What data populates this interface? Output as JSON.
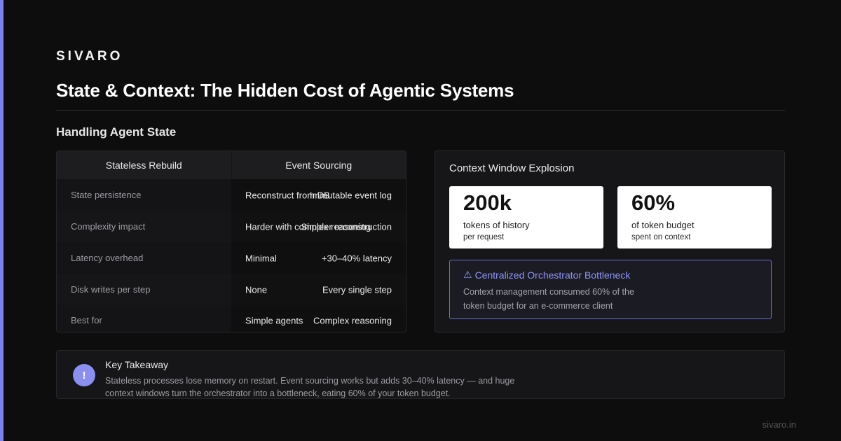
{
  "brand": "SIVARO",
  "title": "State & Context: The Hidden Cost of Agentic Systems",
  "section_title": "Handling Agent State",
  "table": {
    "headers": [
      "Stateless Rebuild",
      "Event Sourcing"
    ],
    "rows": [
      {
        "label": "State persistence",
        "stateless": "Reconstruct from DB",
        "event": "Immutable event log"
      },
      {
        "label": "Complexity impact",
        "stateless": "Harder with complex reasoning",
        "event": "Simpler reconstruction"
      },
      {
        "label": "Latency overhead",
        "stateless": "Minimal",
        "event": "+30–40% latency"
      },
      {
        "label": "Disk writes per step",
        "stateless": "None",
        "event": "Every single step"
      },
      {
        "label": "Best for",
        "stateless": "Simple agents",
        "event": "Complex reasoning"
      }
    ]
  },
  "context_panel": {
    "title": "Context Window Explosion",
    "stats": [
      {
        "value": "200k",
        "label": "tokens of history",
        "sub": "per request"
      },
      {
        "value": "60%",
        "label": "of token budget",
        "sub": "spent on context"
      }
    ],
    "alert": {
      "icon": "warning-icon",
      "icon_glyph": "⚠",
      "title": "Centralized Orchestrator Bottleneck",
      "body": "Context management consumed 60% of the token budget for an e-commerce client"
    }
  },
  "takeaway": {
    "icon_glyph": "!",
    "title": "Key Takeaway",
    "body": "Stateless processes lose memory on restart. Event sourcing works but adds 30–40% latency — and huge context windows turn the orchestrator into a bottleneck, eating 60% of your token budget."
  },
  "footer": "sivaro.in",
  "colors": {
    "accent": "#7b82f0",
    "alert_border": "#6a70d8",
    "background": "#0d0d0e"
  }
}
